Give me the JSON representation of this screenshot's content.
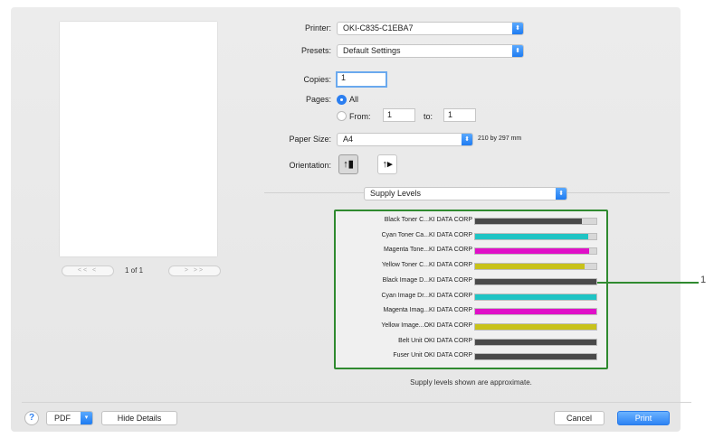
{
  "preview": {
    "prev_buttons": "<<  <",
    "page_indicator": "1 of 1",
    "next_buttons": ">  >>"
  },
  "printer": {
    "label": "Printer:",
    "value": "OKI-C835-C1EBA7"
  },
  "presets": {
    "label": "Presets:",
    "value": "Default Settings"
  },
  "copies": {
    "label": "Copies:",
    "value": "1"
  },
  "pages": {
    "label": "Pages:",
    "all_label": "All",
    "from_label": "From:",
    "from_value": "1",
    "to_label": "to:",
    "to_value": "1",
    "selected": "All"
  },
  "paper_size": {
    "label": "Paper Size:",
    "value": "A4",
    "dimensions": "210 by 297 mm"
  },
  "orientation": {
    "label": "Orientation:",
    "selected": "portrait"
  },
  "section_popup": {
    "value": "Supply Levels"
  },
  "supplies": [
    {
      "name": "Black Toner C...KI DATA CORP",
      "level": 0.88,
      "color": "#4a4a4a"
    },
    {
      "name": "Cyan Toner Ca...KI DATA CORP",
      "level": 0.93,
      "color": "#1fc4c4"
    },
    {
      "name": "Magenta Tone...KI DATA CORP",
      "level": 0.94,
      "color": "#e010c8"
    },
    {
      "name": "Yellow Toner C...KI DATA CORP",
      "level": 0.9,
      "color": "#c8c21a"
    },
    {
      "name": "Black Image D...KI DATA CORP",
      "level": 1.0,
      "color": "#4a4a4a"
    },
    {
      "name": "Cyan Image Dr...KI DATA CORP",
      "level": 1.0,
      "color": "#1fc4c4"
    },
    {
      "name": "Magenta Imag...KI DATA CORP",
      "level": 1.0,
      "color": "#e010c8"
    },
    {
      "name": "Yellow Image...OKI DATA CORP",
      "level": 1.0,
      "color": "#c8c21a"
    },
    {
      "name": "Belt Unit OKI DATA CORP",
      "level": 1.0,
      "color": "#4a4a4a"
    },
    {
      "name": "Fuser Unit OKI DATA CORP",
      "level": 1.0,
      "color": "#4a4a4a"
    }
  ],
  "approx_note": "Supply levels shown are approximate.",
  "callout": "1",
  "footer": {
    "help": "?",
    "pdf_label": "PDF",
    "hide_details_label": "Hide Details",
    "cancel_label": "Cancel",
    "print_label": "Print"
  },
  "accent_color": "#2b7ef0",
  "highlight_color": "#2f8a2f"
}
